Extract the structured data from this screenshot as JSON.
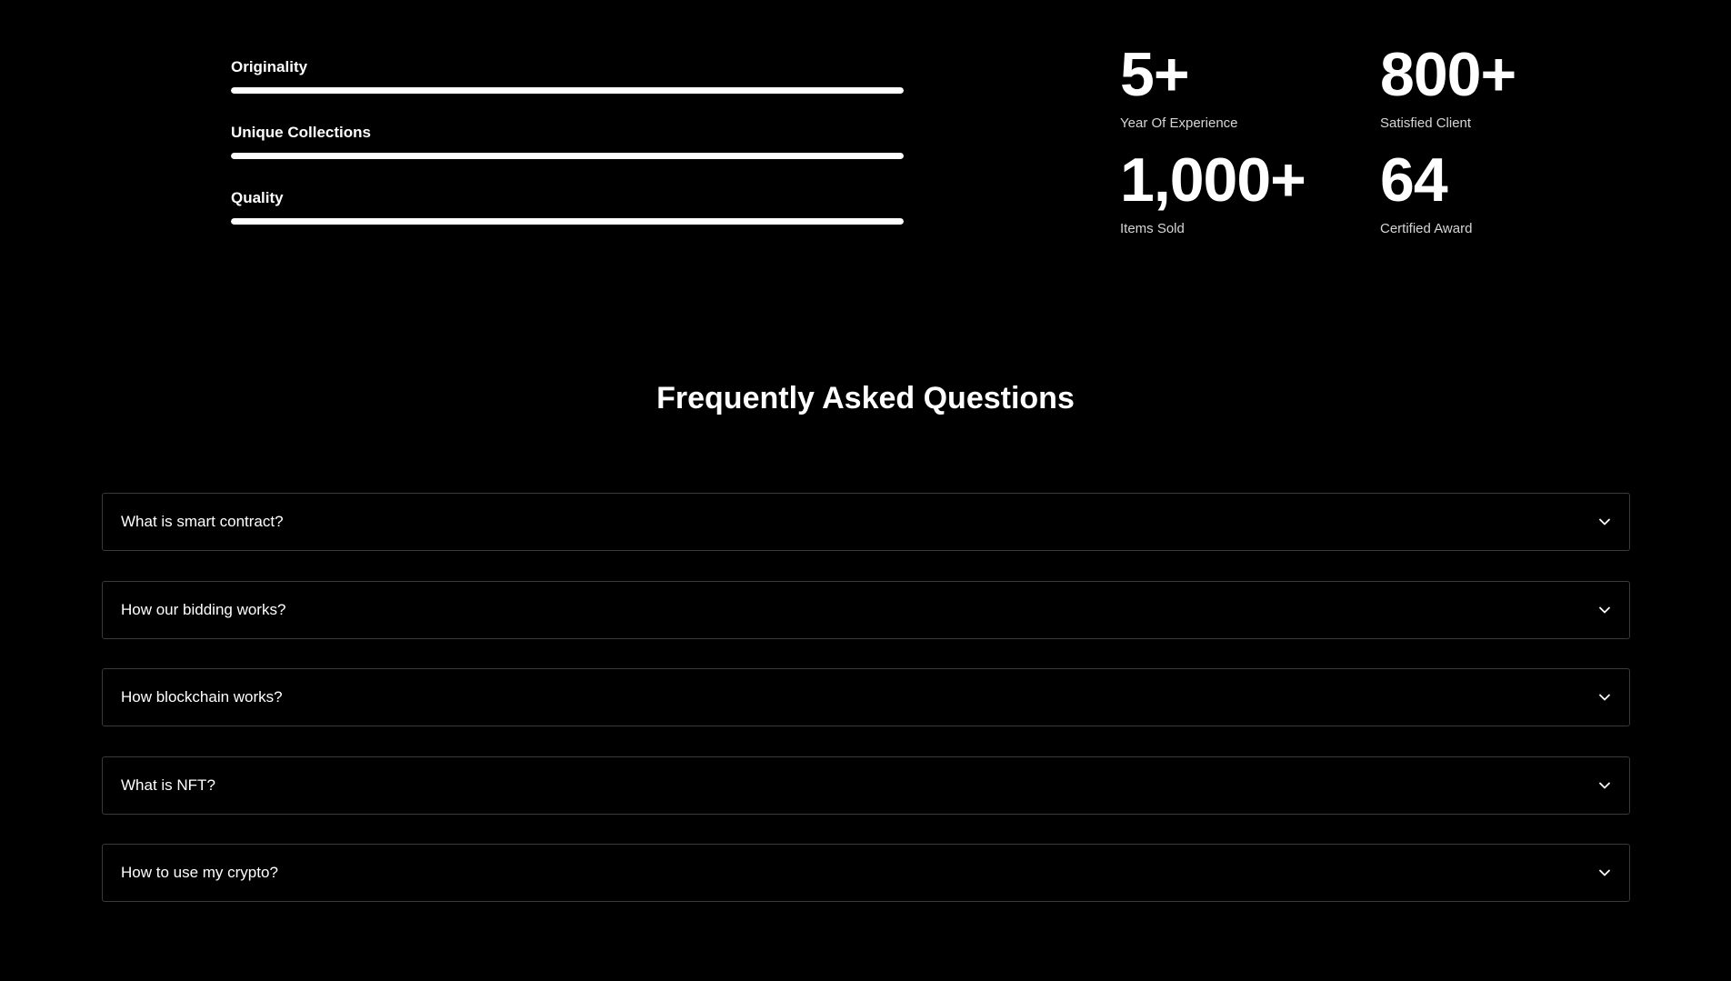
{
  "skills": [
    {
      "label": "Originality",
      "progress": 1.0
    },
    {
      "label": "Unique Collections",
      "progress": 1.0
    },
    {
      "label": "Quality",
      "progress": 1.0
    }
  ],
  "stats": [
    {
      "value": "5+",
      "label": "Year Of Experience"
    },
    {
      "value": "800+",
      "label": "Satisfied Client"
    },
    {
      "value": "1,000+",
      "label": "Items Sold"
    },
    {
      "value": "64",
      "label": "Certified Award"
    }
  ],
  "faq": {
    "title": "Frequently Asked Questions",
    "items": [
      {
        "question": "What is smart contract?",
        "icon": "chevron-down-icon"
      },
      {
        "question": "How our bidding works?",
        "icon": "chevron-down-icon"
      },
      {
        "question": "How blockchain works?",
        "icon": "chevron-down-icon"
      },
      {
        "question": "What is NFT?",
        "icon": "chevron-down-icon"
      },
      {
        "question": "How to use my crypto?",
        "icon": "chevron-down-icon"
      }
    ]
  },
  "colors": {
    "background": "#000000",
    "text": "#ffffff",
    "muted_text": "#d6d6d6",
    "border": "#3a3a3a",
    "progress_fill": "#ffffff"
  }
}
